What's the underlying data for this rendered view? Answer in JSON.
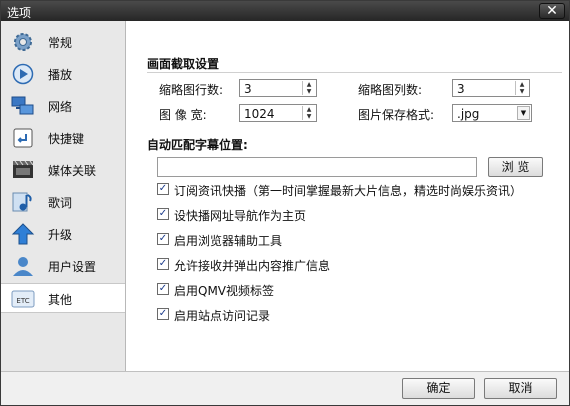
{
  "window": {
    "title": "选项",
    "close_glyph": "✕"
  },
  "sidebar": {
    "items": [
      {
        "label": "常规",
        "icon": "gear-icon"
      },
      {
        "label": "播放",
        "icon": "play-icon"
      },
      {
        "label": "网络",
        "icon": "network-icon"
      },
      {
        "label": "快捷键",
        "icon": "shortcut-key-icon"
      },
      {
        "label": "媒体关联",
        "icon": "film-icon"
      },
      {
        "label": "歌词",
        "icon": "music-note-icon"
      },
      {
        "label": "升级",
        "icon": "upgrade-arrow-icon"
      },
      {
        "label": "用户设置",
        "icon": "user-icon"
      },
      {
        "label": "其他",
        "icon": "etc-icon",
        "active": true
      }
    ]
  },
  "screenshot": {
    "title": "画面截取设置",
    "thumb_rows_label": "缩略图行数:",
    "thumb_rows_value": "3",
    "thumb_cols_label": "缩略图列数:",
    "thumb_cols_value": "3",
    "width_label": "图 像 宽:",
    "width_value": "1024",
    "format_label": "图片保存格式:",
    "format_value": ".jpg"
  },
  "subtitle": {
    "title": "自动匹配字幕位置:",
    "path_value": "",
    "browse_label": "浏 览"
  },
  "options": [
    {
      "label": "订阅资讯快播（第一时间掌握最新大片信息，精选时尚娱乐资讯）",
      "checked": true
    },
    {
      "label": "设快播网址导航作为主页",
      "checked": true
    },
    {
      "label": "启用浏览器辅助工具",
      "checked": true
    },
    {
      "label": "允许接收并弹出内容推广信息",
      "checked": true
    },
    {
      "label": "启用QMV视频标签",
      "checked": true
    },
    {
      "label": "启用站点访问记录",
      "checked": true
    }
  ],
  "footer": {
    "ok_label": "确定",
    "cancel_label": "取消"
  },
  "colors": {
    "titlebar": "#2e2e2e",
    "sidebar_bg": "#e8e8e8",
    "accent": "#1a5fb4"
  }
}
